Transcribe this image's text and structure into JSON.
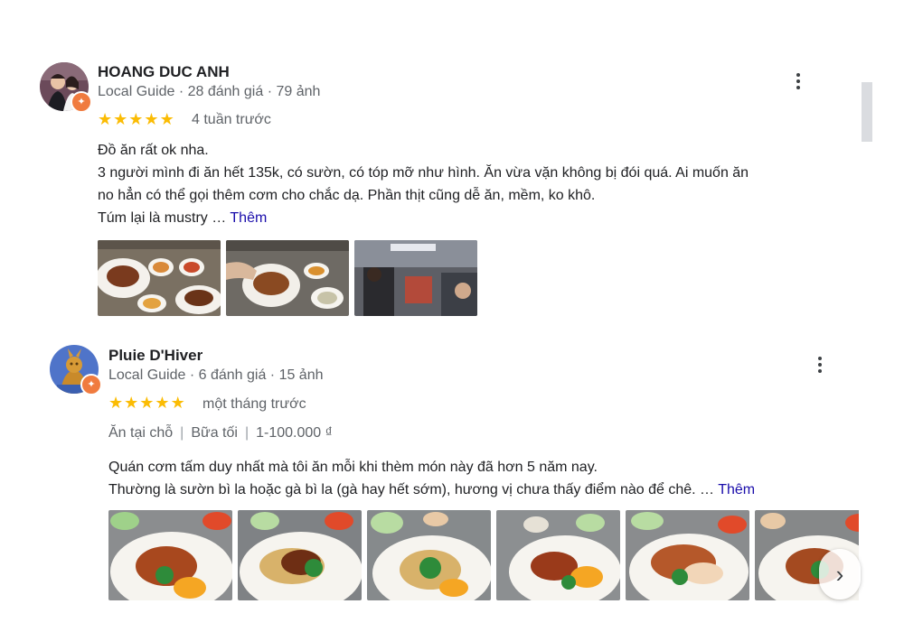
{
  "reviews": [
    {
      "name": "HOANG DUC ANH",
      "meta": "Local Guide · 28 đánh giá · 79 ảnh",
      "stars": 5,
      "time": "4 tuần trước",
      "lines": [
        "Đồ ăn rất ok nha.",
        "3 người mình đi ăn hết 135k, có sườn, có tóp mỡ như hình. Ăn vừa vặn không bị đói quá. Ai muốn ăn",
        "no hẳn có thể gọi thêm cơm cho chắc dạ. Phần thịt cũng dễ ăn, mềm, ko khô.",
        "Túm lại là mustry …"
      ],
      "more": "Thêm"
    },
    {
      "name": "Pluie D'Hiver",
      "meta": "Local Guide · 6 đánh giá · 15 ảnh",
      "stars": 5,
      "time": "một tháng trước",
      "tags": [
        "Ăn tại chỗ",
        "Bữa tối",
        "1-100.000 ₫"
      ],
      "lines": [
        "Quán cơm tấm duy nhất mà tôi ăn mỗi khi thèm món này đã hơn 5 năm nay.",
        "Thường là sườn bì la hoặc gà bì la (gà hay hết sớm), hương vị chưa thấy điểm nào để chê. …"
      ],
      "more": "Thêm"
    }
  ],
  "icons": {
    "star": "★",
    "badge": "✦",
    "next": "›"
  },
  "colors": {
    "star": "#fbbc04",
    "link": "#1a0dab",
    "local_guide_badge": "#f07b3f"
  }
}
